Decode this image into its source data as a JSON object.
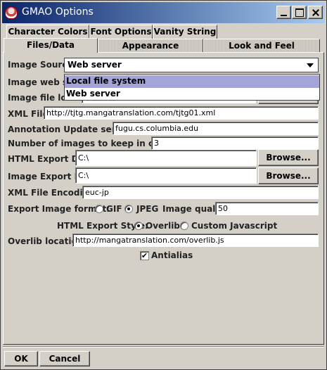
{
  "window": {
    "title": "GMAO Options"
  },
  "tabs": {
    "row1": [
      "Character Colors",
      "Font Options",
      "Vanity String"
    ],
    "row2": [
      "Files/Data",
      "Appearance",
      "Look and Feel"
    ],
    "selected": "Files/Data"
  },
  "form": {
    "image_source": {
      "label": "Image Source",
      "value": "Web server",
      "options": [
        "Local file system",
        "Web server"
      ],
      "highlighted": "Local file system"
    },
    "image_web_server": {
      "label": "Image web se"
    },
    "image_file_location": {
      "label": "Image file loca"
    },
    "xml_file": {
      "label": "XML File:",
      "value": "http://tjtg.mangatranslation.com/tjtg01.xml"
    },
    "annotation_server": {
      "label": "Annotation Update server:",
      "value": "fugu.cs.columbia.edu"
    },
    "cache": {
      "label": "Number of images to keep in cache:",
      "value": "3"
    },
    "html_export_dir": {
      "label": "HTML Export Dir:",
      "value": "C:\\",
      "browse": "Browse..."
    },
    "image_export_dir": {
      "label": "Image Export Dir:",
      "value": "C:\\",
      "browse": "Browse..."
    },
    "xml_encoding": {
      "label": "XML File Encoding:",
      "value": "euc-jp"
    },
    "export_format": {
      "label": "Export Image format:",
      "gif": "GIF",
      "jpeg": "JPEG",
      "quality_label": "Image quality:",
      "quality": "50",
      "selected": "JPEG"
    },
    "html_export_style": {
      "label": "HTML Export Style:",
      "overlib": "Overlib",
      "custom": "Custom Javascript",
      "selected": "Overlib"
    },
    "overlib_location": {
      "label": "Overlib location:",
      "value": "http://mangatranslation.com/overlib.js"
    },
    "antialias": {
      "label": "Antialias",
      "checked": true,
      "mark": "✔"
    }
  },
  "footer": {
    "ok": "OK",
    "cancel": "Cancel"
  }
}
